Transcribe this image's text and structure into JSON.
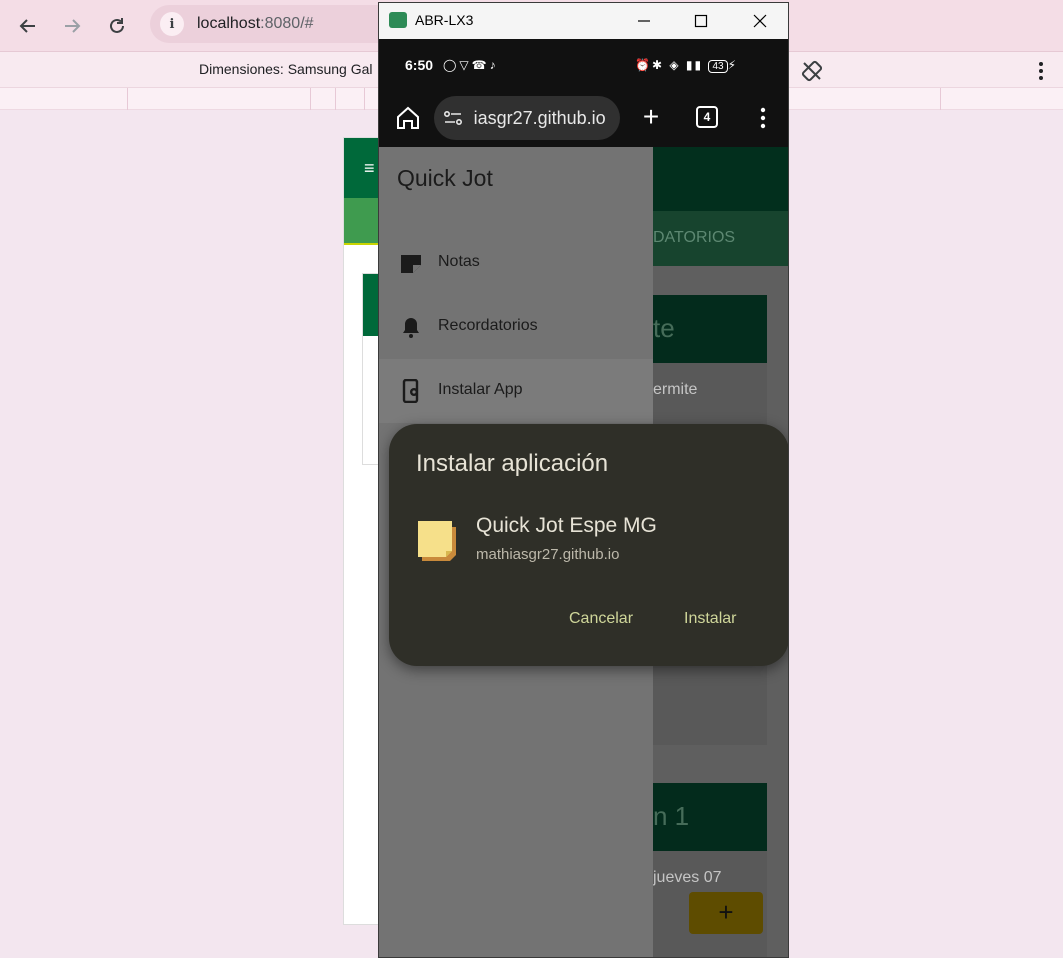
{
  "host_browser": {
    "url_host": "localhost",
    "url_rest": ":8080/#",
    "device_label": "Dimensiones: Samsung Gal"
  },
  "phone_window": {
    "title": "ABR-LX3"
  },
  "status_bar": {
    "time": "6:50",
    "battery": "43"
  },
  "mobile_chrome": {
    "url_text": " iasgr27.github.io",
    "tab_count": "4"
  },
  "drawer": {
    "title": "Quick Jot",
    "items": [
      {
        "label": "Notas",
        "icon": "note-icon"
      },
      {
        "label": "Recordatorios",
        "icon": "bell-icon"
      },
      {
        "label": "Instalar App",
        "icon": "install-app-icon"
      }
    ]
  },
  "background_page": {
    "tab_label": "DATORIOS",
    "cards": [
      {
        "title": "te",
        "subtitle": "ermite"
      },
      {
        "title": "n 1",
        "subtitle": "jueves 07"
      }
    ],
    "fab_label": "+"
  },
  "install_dialog": {
    "title": "Instalar aplicación",
    "app_name": "Quick Jot Espe MG",
    "app_origin": "mathiasgr27.github.io",
    "cancel_label": "Cancelar",
    "install_label": "Instalar"
  },
  "colors": {
    "drawer_bg": "#737373",
    "dialog_bg": "#2f2f28",
    "dialog_button": "#cfd69a",
    "app_header": "#022f1d",
    "host_toolbar": "#f4dde6"
  }
}
